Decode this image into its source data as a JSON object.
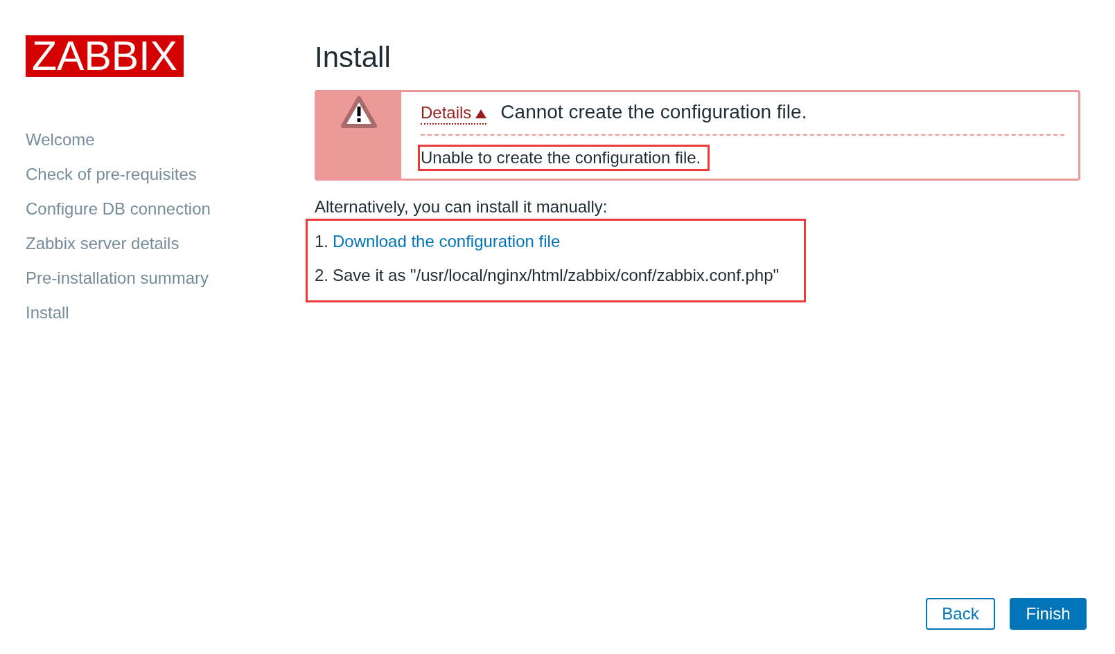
{
  "logo": {
    "text": "ZABBIX"
  },
  "sidebar": {
    "items": [
      {
        "label": "Welcome"
      },
      {
        "label": "Check of pre-requisites"
      },
      {
        "label": "Configure DB connection"
      },
      {
        "label": "Zabbix server details"
      },
      {
        "label": "Pre-installation summary"
      },
      {
        "label": "Install"
      }
    ]
  },
  "title": "Install",
  "alert": {
    "toggle": {
      "label": "Details",
      "expanded": true
    },
    "message": "Cannot create the configuration file.",
    "details": [
      {
        "text": "Unable to create the configuration file.",
        "highlighted": true
      }
    ]
  },
  "intro": "Alternatively, you can install it manually:",
  "manual_steps": {
    "highlighted": true,
    "items": [
      {
        "number": "1.",
        "kind": "link",
        "text": "Download the configuration file"
      },
      {
        "number": "2.",
        "kind": "text",
        "text": "Save it as \"/usr/local/nginx/html/zabbix/conf/zabbix.conf.php\""
      }
    ]
  },
  "buttons": [
    {
      "label": "Back",
      "kind": "secondary"
    },
    {
      "label": "Finish",
      "kind": "primary"
    }
  ]
}
